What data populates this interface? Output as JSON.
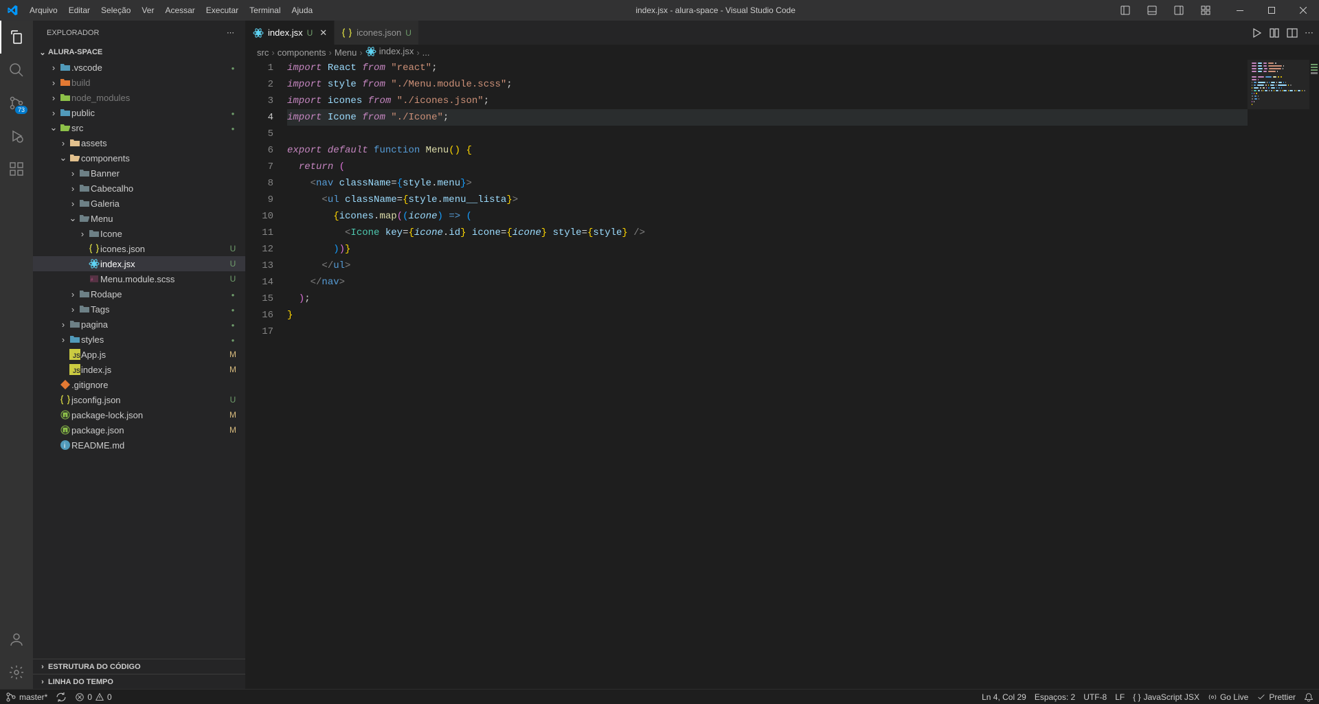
{
  "titlebar": {
    "menus": [
      "Arquivo",
      "Editar",
      "Seleção",
      "Ver",
      "Acessar",
      "Executar",
      "Terminal",
      "Ajuda"
    ],
    "title": "index.jsx - alura-space - Visual Studio Code"
  },
  "activity": {
    "scm_badge": "73"
  },
  "sidebar": {
    "title": "EXPLORADOR",
    "project": "ALURA-SPACE",
    "outline": "ESTRUTURA DO CÓDIGO",
    "timeline": "LINHA DO TEMPO",
    "tree": [
      {
        "depth": 1,
        "twist": ">",
        "icon": "folder",
        "label": ".vscode",
        "dim": false,
        "status": "dot",
        "iconColor": "fico-blue"
      },
      {
        "depth": 1,
        "twist": ">",
        "icon": "folder",
        "label": "build",
        "dim": true,
        "status": "",
        "iconColor": "fico-orange"
      },
      {
        "depth": 1,
        "twist": ">",
        "icon": "folder",
        "label": "node_modules",
        "dim": true,
        "status": "",
        "iconColor": "fico-green"
      },
      {
        "depth": 1,
        "twist": ">",
        "icon": "folder",
        "label": "public",
        "dim": false,
        "status": "dot",
        "iconColor": "fico-blue"
      },
      {
        "depth": 1,
        "twist": "v",
        "icon": "folder-open",
        "label": "src",
        "dim": false,
        "status": "dot",
        "iconColor": "fico-green"
      },
      {
        "depth": 2,
        "twist": ">",
        "icon": "folder",
        "label": "assets",
        "dim": false,
        "status": "",
        "iconColor": "fico-yellow"
      },
      {
        "depth": 2,
        "twist": "v",
        "icon": "folder-open",
        "label": "components",
        "dim": false,
        "status": "",
        "iconColor": "fico-yellow"
      },
      {
        "depth": 3,
        "twist": ">",
        "icon": "folder",
        "label": "Banner",
        "dim": false,
        "status": "",
        "iconColor": "fico-gray"
      },
      {
        "depth": 3,
        "twist": ">",
        "icon": "folder",
        "label": "Cabecalho",
        "dim": false,
        "status": "",
        "iconColor": "fico-gray"
      },
      {
        "depth": 3,
        "twist": ">",
        "icon": "folder",
        "label": "Galeria",
        "dim": false,
        "status": "",
        "iconColor": "fico-gray"
      },
      {
        "depth": 3,
        "twist": "v",
        "icon": "folder-open",
        "label": "Menu",
        "dim": false,
        "status": "",
        "iconColor": "fico-gray"
      },
      {
        "depth": 4,
        "twist": ">",
        "icon": "folder",
        "label": "Icone",
        "dim": false,
        "status": "",
        "iconColor": "fico-gray"
      },
      {
        "depth": 4,
        "twist": "",
        "icon": "json",
        "label": "icones.json",
        "dim": false,
        "status": "U",
        "iconColor": "fico-json"
      },
      {
        "depth": 4,
        "twist": "",
        "icon": "react",
        "label": "index.jsx",
        "dim": false,
        "status": "U",
        "iconColor": "fico-react",
        "selected": true
      },
      {
        "depth": 4,
        "twist": "",
        "icon": "scss",
        "label": "Menu.module.scss",
        "dim": false,
        "status": "U",
        "iconColor": "fico-scss"
      },
      {
        "depth": 3,
        "twist": ">",
        "icon": "folder",
        "label": "Rodape",
        "dim": false,
        "status": "dot",
        "iconColor": "fico-gray"
      },
      {
        "depth": 3,
        "twist": ">",
        "icon": "folder",
        "label": "Tags",
        "dim": false,
        "status": "dot",
        "iconColor": "fico-gray"
      },
      {
        "depth": 2,
        "twist": ">",
        "icon": "folder",
        "label": "pagina",
        "dim": false,
        "status": "dot",
        "iconColor": "fico-gray"
      },
      {
        "depth": 2,
        "twist": ">",
        "icon": "folder",
        "label": "styles",
        "dim": false,
        "status": "dot",
        "iconColor": "fico-blue"
      },
      {
        "depth": 2,
        "twist": "",
        "icon": "js",
        "label": "App.js",
        "dim": false,
        "status": "M",
        "iconColor": "fico-yellow"
      },
      {
        "depth": 2,
        "twist": "",
        "icon": "js",
        "label": "index.js",
        "dim": false,
        "status": "M",
        "iconColor": "fico-yellow"
      },
      {
        "depth": 1,
        "twist": "",
        "icon": "git",
        "label": ".gitignore",
        "dim": false,
        "status": "",
        "iconColor": "fico-orange"
      },
      {
        "depth": 1,
        "twist": "",
        "icon": "json",
        "label": "jsconfig.json",
        "dim": false,
        "status": "U",
        "iconColor": "fico-json"
      },
      {
        "depth": 1,
        "twist": "",
        "icon": "npm",
        "label": "package-lock.json",
        "dim": false,
        "status": "M",
        "iconColor": "fico-green"
      },
      {
        "depth": 1,
        "twist": "",
        "icon": "npm",
        "label": "package.json",
        "dim": false,
        "status": "M",
        "iconColor": "fico-green"
      },
      {
        "depth": 1,
        "twist": "",
        "icon": "readme",
        "label": "README.md",
        "dim": false,
        "status": "",
        "iconColor": "fico-blue"
      }
    ]
  },
  "tabs": [
    {
      "icon": "react",
      "label": "index.jsx",
      "status": "U",
      "active": true,
      "close": true
    },
    {
      "icon": "json",
      "label": "icones.json",
      "status": "U",
      "active": false,
      "close": false
    }
  ],
  "breadcrumb": [
    "src",
    "components",
    "Menu",
    "index.jsx",
    "..."
  ],
  "code": {
    "lines": 17,
    "currentLine": 4,
    "content": [
      [
        {
          "c": "tk-kw",
          "t": "import"
        },
        {
          "c": "",
          "t": " "
        },
        {
          "c": "tk-var",
          "t": "React"
        },
        {
          "c": "",
          "t": " "
        },
        {
          "c": "tk-kw",
          "t": "from"
        },
        {
          "c": "",
          "t": " "
        },
        {
          "c": "tk-str",
          "t": "\"react\""
        },
        {
          "c": "tk-punc",
          "t": ";"
        }
      ],
      [
        {
          "c": "tk-kw",
          "t": "import"
        },
        {
          "c": "",
          "t": " "
        },
        {
          "c": "tk-var",
          "t": "style"
        },
        {
          "c": "",
          "t": " "
        },
        {
          "c": "tk-kw",
          "t": "from"
        },
        {
          "c": "",
          "t": " "
        },
        {
          "c": "tk-str",
          "t": "\"./Menu.module.scss\""
        },
        {
          "c": "tk-punc",
          "t": ";"
        }
      ],
      [
        {
          "c": "tk-kw",
          "t": "import"
        },
        {
          "c": "",
          "t": " "
        },
        {
          "c": "tk-var",
          "t": "icones"
        },
        {
          "c": "",
          "t": " "
        },
        {
          "c": "tk-kw",
          "t": "from"
        },
        {
          "c": "",
          "t": " "
        },
        {
          "c": "tk-str",
          "t": "\"./icones.json\""
        },
        {
          "c": "tk-punc",
          "t": ";"
        }
      ],
      [
        {
          "c": "tk-kw",
          "t": "import"
        },
        {
          "c": "",
          "t": " "
        },
        {
          "c": "tk-var",
          "t": "Icone"
        },
        {
          "c": "",
          "t": " "
        },
        {
          "c": "tk-kw",
          "t": "from"
        },
        {
          "c": "",
          "t": " "
        },
        {
          "c": "tk-str",
          "t": "\"./Icone\""
        },
        {
          "c": "tk-punc",
          "t": ";"
        }
      ],
      [],
      [
        {
          "c": "tk-kw",
          "t": "export"
        },
        {
          "c": "",
          "t": " "
        },
        {
          "c": "tk-kw",
          "t": "default"
        },
        {
          "c": "",
          "t": " "
        },
        {
          "c": "tk-kw2",
          "t": "function"
        },
        {
          "c": "",
          "t": " "
        },
        {
          "c": "tk-fn",
          "t": "Menu"
        },
        {
          "c": "tk-br1",
          "t": "()"
        },
        {
          "c": "",
          "t": " "
        },
        {
          "c": "tk-br1",
          "t": "{"
        }
      ],
      [
        {
          "c": "",
          "t": "  "
        },
        {
          "c": "tk-kw",
          "t": "return"
        },
        {
          "c": "",
          "t": " "
        },
        {
          "c": "tk-br2",
          "t": "("
        }
      ],
      [
        {
          "c": "",
          "t": "    "
        },
        {
          "c": "tk-gray",
          "t": "<"
        },
        {
          "c": "tk-tag",
          "t": "nav"
        },
        {
          "c": "",
          "t": " "
        },
        {
          "c": "tk-attr",
          "t": "className"
        },
        {
          "c": "tk-punc",
          "t": "="
        },
        {
          "c": "tk-br3",
          "t": "{"
        },
        {
          "c": "tk-var",
          "t": "style"
        },
        {
          "c": "tk-punc",
          "t": "."
        },
        {
          "c": "tk-var",
          "t": "menu"
        },
        {
          "c": "tk-br3",
          "t": "}"
        },
        {
          "c": "tk-gray",
          "t": ">"
        }
      ],
      [
        {
          "c": "",
          "t": "      "
        },
        {
          "c": "tk-gray",
          "t": "<"
        },
        {
          "c": "tk-tag",
          "t": "ul"
        },
        {
          "c": "",
          "t": " "
        },
        {
          "c": "tk-attr",
          "t": "className"
        },
        {
          "c": "tk-punc",
          "t": "="
        },
        {
          "c": "tk-br1",
          "t": "{"
        },
        {
          "c": "tk-var",
          "t": "style"
        },
        {
          "c": "tk-punc",
          "t": "."
        },
        {
          "c": "tk-var",
          "t": "menu__lista"
        },
        {
          "c": "tk-br1",
          "t": "}"
        },
        {
          "c": "tk-gray",
          "t": ">"
        }
      ],
      [
        {
          "c": "",
          "t": "        "
        },
        {
          "c": "tk-br1",
          "t": "{"
        },
        {
          "c": "tk-var",
          "t": "icones"
        },
        {
          "c": "tk-punc",
          "t": "."
        },
        {
          "c": "tk-fn",
          "t": "map"
        },
        {
          "c": "tk-br2",
          "t": "("
        },
        {
          "c": "tk-br3",
          "t": "("
        },
        {
          "c": "tk-varit",
          "t": "icone"
        },
        {
          "c": "tk-br3",
          "t": ")"
        },
        {
          "c": "",
          "t": " "
        },
        {
          "c": "tk-kw2",
          "t": "=>"
        },
        {
          "c": "",
          "t": " "
        },
        {
          "c": "tk-br3",
          "t": "("
        }
      ],
      [
        {
          "c": "",
          "t": "          "
        },
        {
          "c": "tk-gray",
          "t": "<"
        },
        {
          "c": "tk-comp",
          "t": "Icone"
        },
        {
          "c": "",
          "t": " "
        },
        {
          "c": "tk-attr",
          "t": "key"
        },
        {
          "c": "tk-punc",
          "t": "="
        },
        {
          "c": "tk-br1",
          "t": "{"
        },
        {
          "c": "tk-varit",
          "t": "icone"
        },
        {
          "c": "tk-punc",
          "t": "."
        },
        {
          "c": "tk-var",
          "t": "id"
        },
        {
          "c": "tk-br1",
          "t": "}"
        },
        {
          "c": "",
          "t": " "
        },
        {
          "c": "tk-attr",
          "t": "icone"
        },
        {
          "c": "tk-punc",
          "t": "="
        },
        {
          "c": "tk-br1",
          "t": "{"
        },
        {
          "c": "tk-varit",
          "t": "icone"
        },
        {
          "c": "tk-br1",
          "t": "}"
        },
        {
          "c": "",
          "t": " "
        },
        {
          "c": "tk-attr",
          "t": "style"
        },
        {
          "c": "tk-punc",
          "t": "="
        },
        {
          "c": "tk-br1",
          "t": "{"
        },
        {
          "c": "tk-var",
          "t": "style"
        },
        {
          "c": "tk-br1",
          "t": "}"
        },
        {
          "c": "",
          "t": " "
        },
        {
          "c": "tk-gray",
          "t": "/>"
        }
      ],
      [
        {
          "c": "",
          "t": "        "
        },
        {
          "c": "tk-br3",
          "t": ")"
        },
        {
          "c": "tk-br2",
          "t": ")"
        },
        {
          "c": "tk-br1",
          "t": "}"
        }
      ],
      [
        {
          "c": "",
          "t": "      "
        },
        {
          "c": "tk-gray",
          "t": "</"
        },
        {
          "c": "tk-tag",
          "t": "ul"
        },
        {
          "c": "tk-gray",
          "t": ">"
        }
      ],
      [
        {
          "c": "",
          "t": "    "
        },
        {
          "c": "tk-gray",
          "t": "</"
        },
        {
          "c": "tk-tag",
          "t": "nav"
        },
        {
          "c": "tk-gray",
          "t": ">"
        }
      ],
      [
        {
          "c": "",
          "t": "  "
        },
        {
          "c": "tk-br2",
          "t": ")"
        },
        {
          "c": "tk-punc",
          "t": ";"
        }
      ],
      [
        {
          "c": "tk-br1",
          "t": "}"
        }
      ],
      []
    ]
  },
  "statusbar": {
    "branch": "master*",
    "sync": "",
    "errors": "0",
    "warnings": "0",
    "position": "Ln 4, Col 29",
    "spaces": "Espaços: 2",
    "encoding": "UTF-8",
    "eol": "LF",
    "language": "JavaScript JSX",
    "golive": "Go Live",
    "prettier": "Prettier"
  }
}
